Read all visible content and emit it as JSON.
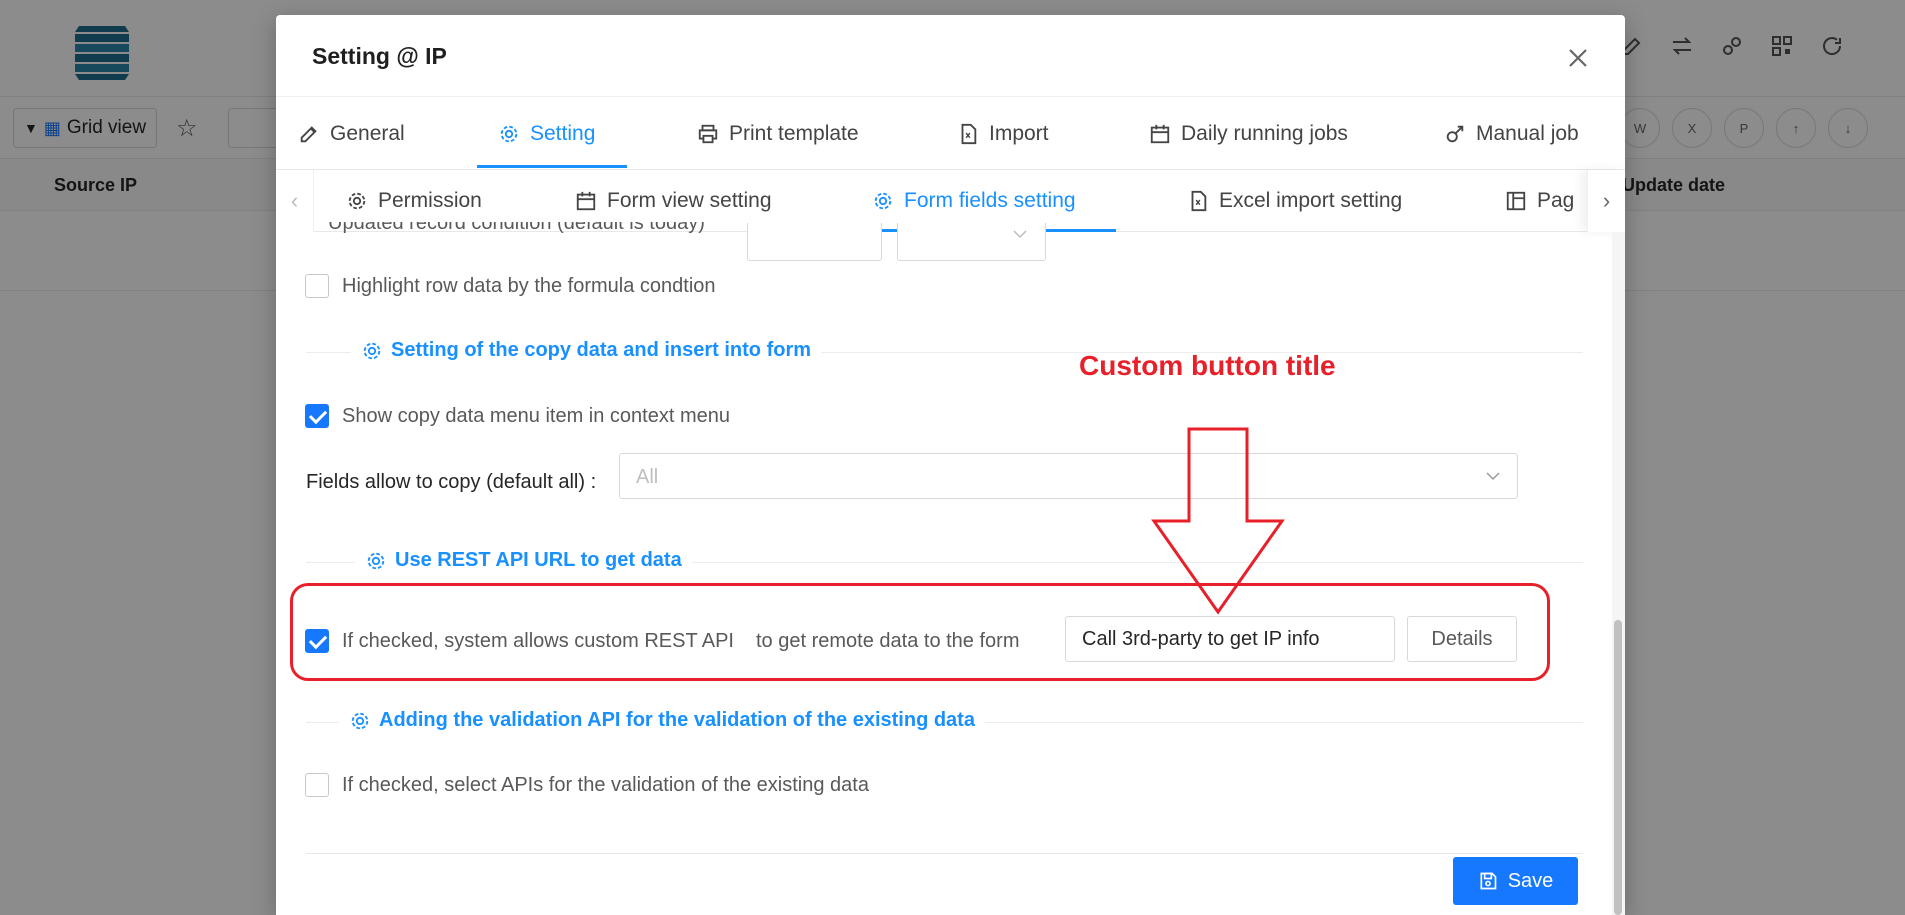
{
  "background": {
    "view_button_label": "Grid view",
    "columns": [
      "Source IP",
      "Update date"
    ],
    "toolbar_icons": [
      "edit-icon",
      "swap-icon",
      "link-icon",
      "qrcode-icon",
      "refresh-icon"
    ],
    "export_icons": [
      "word-icon",
      "excel-icon",
      "pdf-icon",
      "upload-icon",
      "download-icon"
    ]
  },
  "modal": {
    "title": "Setting @ IP",
    "tabs": [
      {
        "label": "General",
        "icon": "edit-icon"
      },
      {
        "label": "Setting",
        "icon": "gear-icon",
        "active": true
      },
      {
        "label": "Print template",
        "icon": "printer-icon"
      },
      {
        "label": "Import",
        "icon": "file-import-icon"
      },
      {
        "label": "Daily running jobs",
        "icon": "calendar-icon"
      },
      {
        "label": "Manual job",
        "icon": "manual-job-icon"
      }
    ],
    "subtabs": [
      {
        "label": "Permission",
        "icon": "gear-icon"
      },
      {
        "label": "Form view setting",
        "icon": "calendar-icon"
      },
      {
        "label": "Form fields setting",
        "icon": "gear-icon",
        "active": true
      },
      {
        "label": "Excel import setting",
        "icon": "file-excel-icon"
      },
      {
        "label": "Pag",
        "icon": "layout-icon"
      }
    ],
    "content": {
      "updated_condition_label": "Updated record condition (default is today)",
      "highlight_row": {
        "label": "Highlight row data by the formula condtion",
        "checked": false
      },
      "copy_section": {
        "title": "Setting of the copy data and insert into form",
        "show_copy_menu": {
          "label": "Show copy data menu item in context menu",
          "checked": true
        },
        "fields_allow_label": "Fields allow to copy (default all)",
        "fields_allow_value": "All"
      },
      "rest_section": {
        "title": "Use REST API URL to get data",
        "checkbox_label": "If checked, system allows custom REST API",
        "checked": true,
        "suffix_label": "to get remote data to the form",
        "button_title_value": "Call 3rd-party to get IP info",
        "details_button": "Details"
      },
      "validation_section": {
        "title": "Adding the validation API for the validation of the existing data",
        "checkbox_label": "If checked, select APIs for the validation of the existing data",
        "checked": false
      }
    },
    "save_button": "Save"
  },
  "annotation": {
    "text": "Custom button title",
    "color": "#e8202a"
  },
  "colors": {
    "accent": "#1890ff",
    "primary_button": "#1677ff",
    "annotation_red": "#e8202a"
  }
}
